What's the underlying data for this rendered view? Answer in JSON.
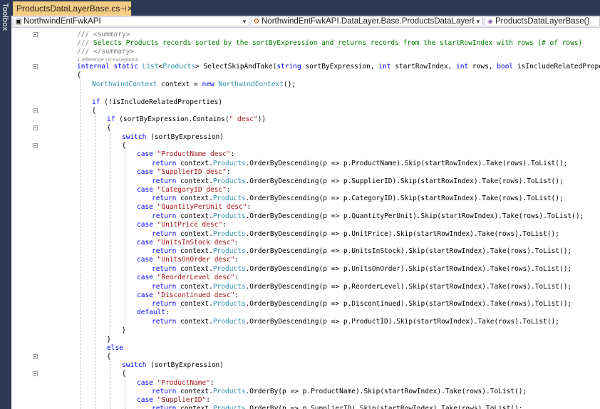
{
  "sidebar": {
    "toolbox_label": "Toolbox"
  },
  "tab": {
    "title": "ProductsDataLayerBase.cs",
    "pin_glyph": "⊣",
    "close_glyph": "✕"
  },
  "navbar": {
    "project": "NorthwindEntFwkAPI",
    "type": "NorthwindEntFwkAPI.DataLayer.Base.ProductsDataLayerBase",
    "member": "ProductsDataLayerBase()"
  },
  "code_lens": "1 reference | 0 exceptions",
  "code_lines": [
    "/// <summary>",
    "/// Selects Products records sorted by the sortByExpression and returns records from the startRowIndex with rows (# of rows)",
    "/// </summary>",
    "internal static List<Products> SelectSkipAndTake(string sortByExpression, int startRowIndex, int rows, bool isIncludeRelatedProperties = true)",
    "{",
    "NorthwindContext context = new NorthwindContext();",
    "",
    "if (!isIncludeRelatedProperties)",
    "{",
    "if (sortByExpression.Contains(\" desc\"))",
    "{",
    "switch (sortByExpression)",
    "{",
    "case \"ProductName desc\":",
    "return context.Products.OrderByDescending(p => p.ProductName).Skip(startRowIndex).Take(rows).ToList();",
    "case \"SupplierID desc\":",
    "return context.Products.OrderByDescending(p => p.SupplierID).Skip(startRowIndex).Take(rows).ToList();",
    "case \"CategoryID desc\":",
    "return context.Products.OrderByDescending(p => p.CategoryID).Skip(startRowIndex).Take(rows).ToList();",
    "case \"QuantityPerUnit desc\":",
    "return context.Products.OrderByDescending(p => p.QuantityPerUnit).Skip(startRowIndex).Take(rows).ToList();",
    "case \"UnitPrice desc\":",
    "return context.Products.OrderByDescending(p => p.UnitPrice).Skip(startRowIndex).Take(rows).ToList();",
    "case \"UnitsInStock desc\":",
    "return context.Products.OrderByDescending(p => p.UnitsInStock).Skip(startRowIndex).Take(rows).ToList();",
    "case \"UnitsOnOrder desc\":",
    "return context.Products.OrderByDescending(p => p.UnitsOnOrder).Skip(startRowIndex).Take(rows).ToList();",
    "case \"ReorderLevel desc\":",
    "return context.Products.OrderByDescending(p => p.ReorderLevel).Skip(startRowIndex).Take(rows).ToList();",
    "case \"Discontinued desc\":",
    "return context.Products.OrderByDescending(p => p.Discontinued).Skip(startRowIndex).Take(rows).ToList();",
    "default:",
    "return context.Products.OrderByDescending(p => p.ProductID).Skip(startRowIndex).Take(rows).ToList();",
    "}",
    "}",
    "else",
    "{",
    "switch (sortByExpression)",
    "{",
    "case \"ProductName\":",
    "return context.Products.OrderBy(p => p.ProductName).Skip(startRowIndex).Take(rows).ToList();",
    "case \"SupplierID\":",
    "return context.Products.OrderBy(p => p.SupplierID).Skip(startRowIndex).Take(rows).ToList();"
  ]
}
